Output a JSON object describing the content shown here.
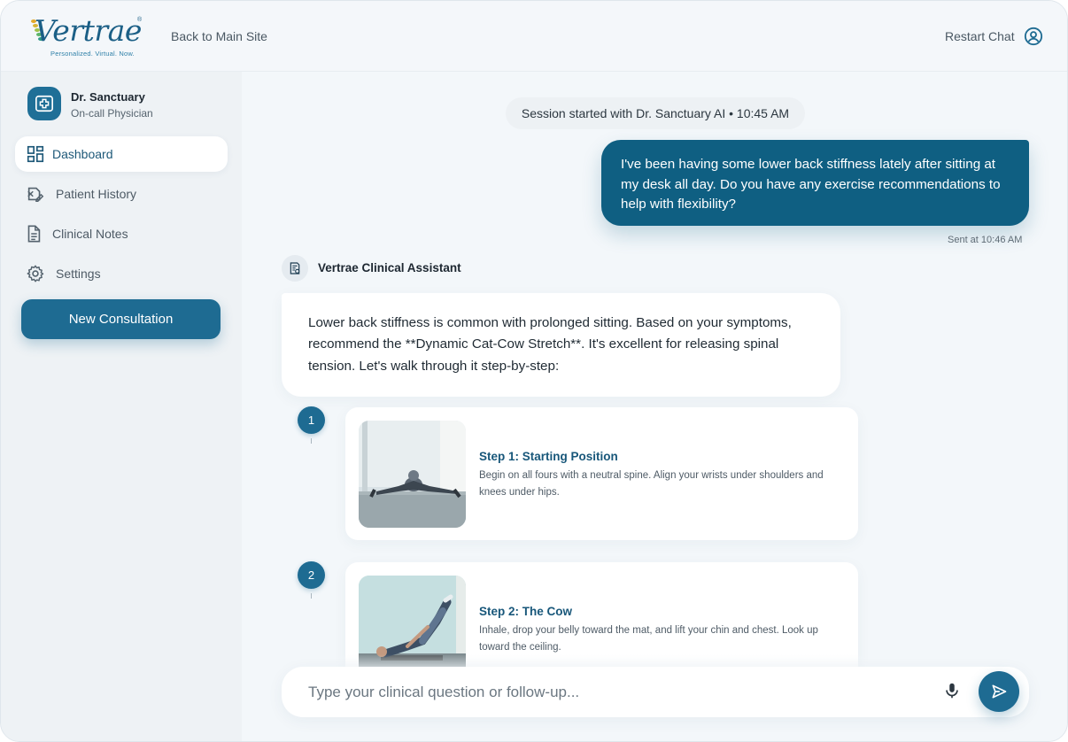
{
  "header": {
    "logo_text": "Vertrae",
    "logo_mark": "®",
    "logo_tagline": "Personalized. Virtual. Now.",
    "back_link": "Back to Main Site",
    "restart_chat": "Restart Chat"
  },
  "sidebar": {
    "doctor_name": "Dr. Sanctuary",
    "doctor_role": "On-call Physician",
    "nav": [
      {
        "label": "Dashboard",
        "icon": "dashboard-icon",
        "active": true
      },
      {
        "label": "Patient History",
        "icon": "patient-history-icon",
        "active": false
      },
      {
        "label": "Clinical Notes",
        "icon": "document-icon",
        "active": false
      },
      {
        "label": "Settings",
        "icon": "gear-icon",
        "active": false
      }
    ],
    "new_consultation": "New Consultation"
  },
  "chat": {
    "session_text": "Session started with Dr. Sanctuary AI • 10:45 AM",
    "user_message": "I've been having some lower back stiffness lately after sitting at my desk all day. Do you have any exercise recommendations to help with flexibility?",
    "sent_time": "Sent at 10:46 AM",
    "assistant_name": "Vertrae Clinical Assistant",
    "assistant_message": "Lower back stiffness is common with prolonged sitting. Based on your symptoms, recommend the **Dynamic Cat-Cow Stretch**. It's excellent for releasing spinal tension. Let's walk through it step-by-step:",
    "steps": [
      {
        "number": "1",
        "title": "Step 1: Starting Position",
        "description": "Begin on all fours with a neutral spine. Align your wrists under shoulders and knees under hips."
      },
      {
        "number": "2",
        "title": "Step 2: The Cow",
        "description": "Inhale, drop your belly toward the mat, and lift your chin and chest. Look up toward the ceiling."
      }
    ]
  },
  "composer": {
    "placeholder": "Type your clinical question or follow-up..."
  },
  "colors": {
    "brand": "#1e6b92",
    "user_bubble": "#0f5f82",
    "background": "#f3f7fa"
  }
}
